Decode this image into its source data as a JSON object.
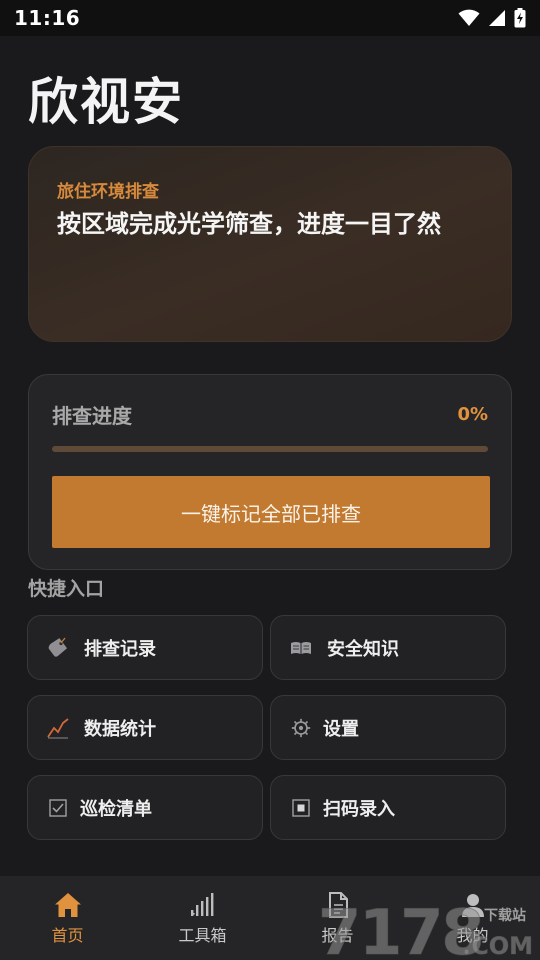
{
  "status_bar": {
    "time": "11:16"
  },
  "app": {
    "title": "欣视安"
  },
  "hero": {
    "eyebrow": "旅住环境排查",
    "headline": "按区域完成光学筛查，进度一目了然"
  },
  "progress": {
    "label": "排查进度",
    "percent_text": "0%",
    "value": 0,
    "button_label": "一键标记全部已排查"
  },
  "shortcuts": {
    "title": "快捷入口",
    "items": [
      {
        "label": "排查记录",
        "icon": "tag-icon"
      },
      {
        "label": "安全知识",
        "icon": "book-icon"
      },
      {
        "label": "数据统计",
        "icon": "trend-icon"
      },
      {
        "label": "设置",
        "icon": "gear-icon"
      },
      {
        "label": "巡检清单",
        "icon": "checkbox-icon"
      },
      {
        "label": "扫码录入",
        "icon": "square-icon"
      }
    ]
  },
  "bottom_nav": {
    "items": [
      {
        "label": "首页",
        "icon": "home-icon",
        "active": true
      },
      {
        "label": "工具箱",
        "icon": "signal-bars-icon",
        "active": false
      },
      {
        "label": "报告",
        "icon": "document-icon",
        "active": false
      },
      {
        "label": "我的",
        "icon": "person-icon",
        "active": false
      }
    ]
  },
  "watermark": {
    "number": "7178",
    "tag": "下载站",
    "domain": ".COM"
  },
  "colors": {
    "accent": "#c27a30",
    "accent_text": "#e0923e",
    "background": "#1a1a1c",
    "card": "#252527"
  }
}
